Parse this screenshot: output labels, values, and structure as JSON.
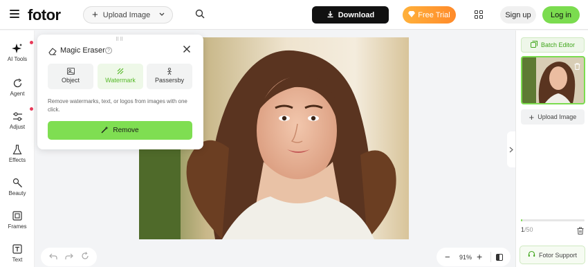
{
  "header": {
    "logo": "fotor",
    "upload_label": "Upload Image",
    "download_label": "Download",
    "trial_label": "Free Trial",
    "signup_label": "Sign up",
    "login_label": "Log in"
  },
  "sidebar": {
    "items": [
      {
        "label": "AI Tools",
        "icon": "sparkle-icon"
      },
      {
        "label": "Agent",
        "icon": "agent-icon"
      },
      {
        "label": "Adjust",
        "icon": "sliders-icon"
      },
      {
        "label": "Effects",
        "icon": "flask-icon"
      },
      {
        "label": "Beauty",
        "icon": "brush-icon"
      },
      {
        "label": "Frames",
        "icon": "frame-icon"
      },
      {
        "label": "Text",
        "icon": "text-icon"
      }
    ]
  },
  "panel": {
    "title": "Magic Eraser",
    "modes": [
      {
        "label": "Object",
        "icon": "object-icon"
      },
      {
        "label": "Watermark",
        "icon": "watermark-icon"
      },
      {
        "label": "Passersby",
        "icon": "person-icon"
      }
    ],
    "active_mode": "Watermark",
    "description": "Remove watermarks, text, or logos from images with one click.",
    "remove_label": "Remove"
  },
  "canvas": {
    "zoom": "91%"
  },
  "rightbar": {
    "batch_label": "Batch Editor",
    "upload_label": "Upload Image",
    "count_current": "1",
    "count_total": "/50",
    "progress": 0.02,
    "support_label": "Fotor Support"
  },
  "colors": {
    "accent_green": "#7bdc4f",
    "trial_orange": "#ff9a30",
    "notification_dot": "#e83b5a"
  }
}
